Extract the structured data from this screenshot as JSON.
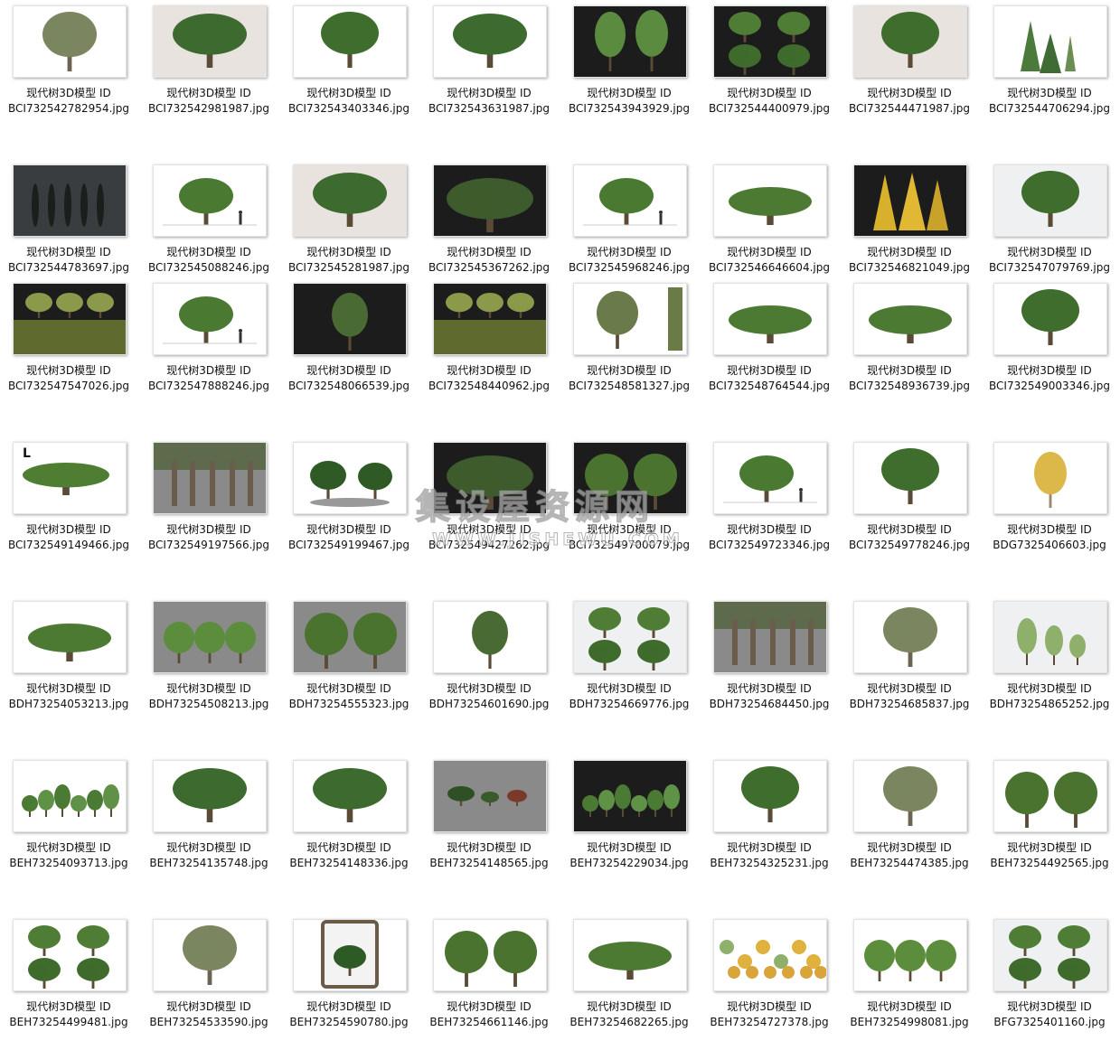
{
  "caption_prefix": "现代树3D模型 ID",
  "watermark": {
    "main": "集设屋资源网",
    "sub": "WWW.JISHEWU.COM"
  },
  "files": [
    {
      "id": "BCI732542782954.jpg",
      "bg": "white",
      "motif": "olive"
    },
    {
      "id": "BCI732542981987.jpg",
      "bg": "beige",
      "motif": "broad"
    },
    {
      "id": "BCI732543403346.jpg",
      "bg": "white",
      "motif": "round"
    },
    {
      "id": "BCI732543631987.jpg",
      "bg": "white",
      "motif": "broad"
    },
    {
      "id": "BCI732543943929.jpg",
      "bg": "dark",
      "motif": "two-tall"
    },
    {
      "id": "BCI732544400979.jpg",
      "bg": "dark",
      "motif": "four"
    },
    {
      "id": "BCI732544471987.jpg",
      "bg": "beige",
      "motif": "round"
    },
    {
      "id": "BCI732544706294.jpg",
      "bg": "white",
      "motif": "conifers"
    },
    {
      "id": "BCI732544783697.jpg",
      "bg": "gray-dark",
      "motif": "cypress"
    },
    {
      "id": "BCI732545088246.jpg",
      "bg": "white",
      "motif": "small-person"
    },
    {
      "id": "BCI732545281987.jpg",
      "bg": "beige",
      "motif": "broad"
    },
    {
      "id": "BCI732545367262.jpg",
      "bg": "dark",
      "motif": "bush"
    },
    {
      "id": "BCI732545968246.jpg",
      "bg": "white",
      "motif": "small-person"
    },
    {
      "id": "BCI732546646604.jpg",
      "bg": "white",
      "motif": "spread"
    },
    {
      "id": "BCI732546821049.jpg",
      "bg": "dark",
      "motif": "yellow"
    },
    {
      "id": "BCI732547079769.jpg",
      "bg": "light",
      "motif": "round"
    },
    {
      "id": "BCI732547547026.jpg",
      "bg": "dark",
      "motif": "canopy"
    },
    {
      "id": "BCI732547888246.jpg",
      "bg": "white",
      "motif": "small-person"
    },
    {
      "id": "BCI732548066539.jpg",
      "bg": "dark",
      "motif": "thin"
    },
    {
      "id": "BCI732548440962.jpg",
      "bg": "dark",
      "motif": "canopy"
    },
    {
      "id": "BCI732548581327.jpg",
      "bg": "white",
      "motif": "palm"
    },
    {
      "id": "BCI732548764544.jpg",
      "bg": "white",
      "motif": "spread"
    },
    {
      "id": "BCI732548936739.jpg",
      "bg": "white",
      "motif": "spread"
    },
    {
      "id": "BCI732549003346.jpg",
      "bg": "white",
      "motif": "round"
    },
    {
      "id": "BCI732549149466.jpg",
      "bg": "white",
      "motif": "wide-L"
    },
    {
      "id": "BCI732549197566.jpg",
      "bg": "gray",
      "motif": "banyan"
    },
    {
      "id": "BCI732549199467.jpg",
      "bg": "white",
      "motif": "bonsai"
    },
    {
      "id": "BCI732549427262.jpg",
      "bg": "dark",
      "motif": "bush"
    },
    {
      "id": "BCI732549700079.jpg",
      "bg": "dark",
      "motif": "two-round"
    },
    {
      "id": "BCI732549723346.jpg",
      "bg": "white",
      "motif": "small-person"
    },
    {
      "id": "BCI732549778246.jpg",
      "bg": "white",
      "motif": "round"
    },
    {
      "id": "BDG7325406603.jpg",
      "bg": "white",
      "motif": "yellow-single"
    },
    {
      "id": "BDH73254053213.jpg",
      "bg": "white",
      "motif": "spread"
    },
    {
      "id": "BDH73254508213.jpg",
      "bg": "gray",
      "motif": "three"
    },
    {
      "id": "BDH73254555323.jpg",
      "bg": "gray",
      "motif": "two-round"
    },
    {
      "id": "BDH73254601690.jpg",
      "bg": "white",
      "motif": "thin"
    },
    {
      "id": "BDH73254669776.jpg",
      "bg": "light",
      "motif": "four"
    },
    {
      "id": "BDH73254684450.jpg",
      "bg": "gray",
      "motif": "banyan"
    },
    {
      "id": "BDH73254685837.jpg",
      "bg": "white",
      "motif": "olive"
    },
    {
      "id": "BDH73254865252.jpg",
      "bg": "light",
      "motif": "sparse"
    },
    {
      "id": "BEH73254093713.jpg",
      "bg": "white",
      "motif": "many"
    },
    {
      "id": "BEH73254135748.jpg",
      "bg": "white",
      "motif": "broad"
    },
    {
      "id": "BEH73254148336.jpg",
      "bg": "white",
      "motif": "broad"
    },
    {
      "id": "BEH73254148565.jpg",
      "bg": "gray",
      "motif": "small-row"
    },
    {
      "id": "BEH73254229034.jpg",
      "bg": "dark",
      "motif": "many"
    },
    {
      "id": "BEH73254325231.jpg",
      "bg": "white",
      "motif": "round"
    },
    {
      "id": "BEH73254474385.jpg",
      "bg": "white",
      "motif": "olive"
    },
    {
      "id": "BEH73254492565.jpg",
      "bg": "white",
      "motif": "two-round"
    },
    {
      "id": "BEH73254499481.jpg",
      "bg": "white",
      "motif": "four"
    },
    {
      "id": "BEH73254533590.jpg",
      "bg": "white",
      "motif": "olive"
    },
    {
      "id": "BEH73254590780.jpg",
      "bg": "white",
      "motif": "planter"
    },
    {
      "id": "BEH73254661146.jpg",
      "bg": "white",
      "motif": "two-round"
    },
    {
      "id": "BEH73254682265.jpg",
      "bg": "white",
      "motif": "spread"
    },
    {
      "id": "BEH73254727378.jpg",
      "bg": "white",
      "motif": "many-yellow"
    },
    {
      "id": "BEH73254998081.jpg",
      "bg": "white",
      "motif": "three"
    },
    {
      "id": "BFG7325401160.jpg",
      "bg": "light",
      "motif": "four"
    }
  ]
}
